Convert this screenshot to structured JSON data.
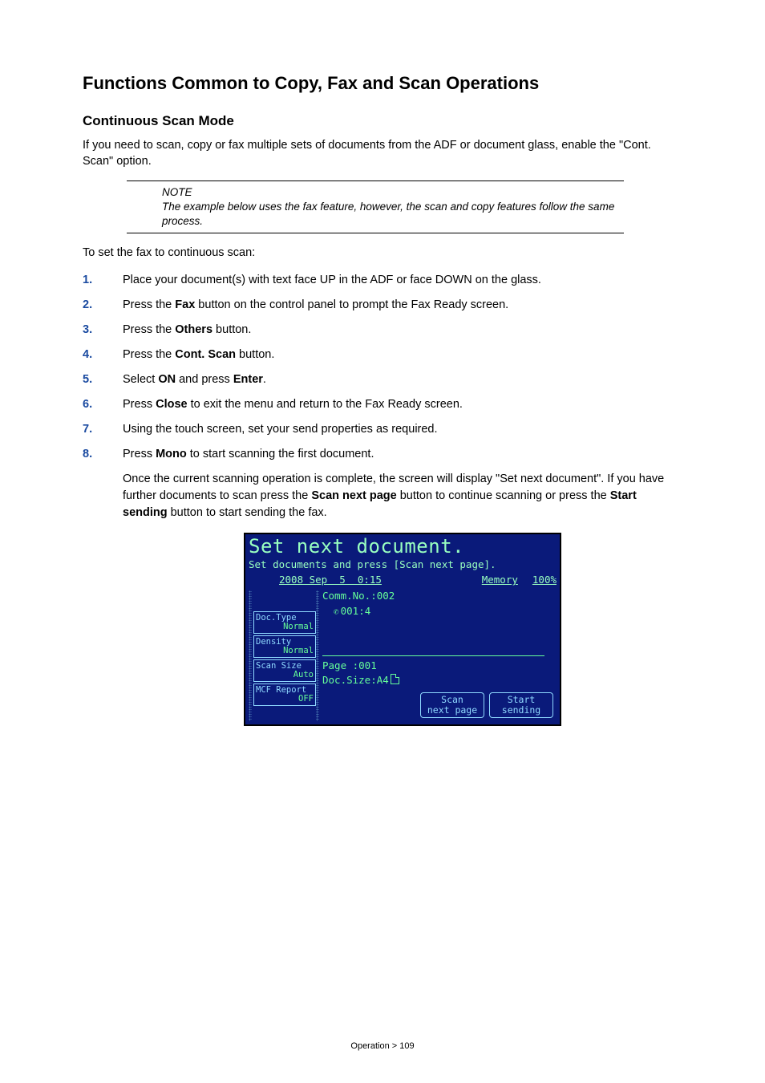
{
  "section": {
    "title": "Functions Common to Copy, Fax and Scan Operations",
    "subtitle": "Continuous Scan Mode",
    "intro": "If you need to scan, copy or fax multiple sets of documents from the ADF or document glass, enable the \"Cont. Scan\" option."
  },
  "note": {
    "label": "NOTE",
    "text": "The example below uses the fax feature, however, the scan and copy features follow the same process."
  },
  "steps_intro": "To set the fax to continuous scan:",
  "steps": [
    {
      "pre": "Place your document(s) with text face UP in the ADF or face DOWN on the glass."
    },
    {
      "pre": "Press the ",
      "bold": "Fax",
      "post": " button on the control panel to prompt the Fax Ready screen."
    },
    {
      "pre": "Press the ",
      "bold": "Others",
      "post": " button."
    },
    {
      "pre": "Press the ",
      "bold": "Cont. Scan",
      "post": " button."
    },
    {
      "pre": "Select ",
      "bold": "ON",
      "post": " and press ",
      "bold2": "Enter",
      "post2": "."
    },
    {
      "pre": "Press ",
      "bold": "Close",
      "post": " to exit the menu and return to the Fax Ready screen."
    },
    {
      "pre": "Using the touch screen, set your send properties as required."
    },
    {
      "pre": "Press ",
      "bold": "Mono",
      "post": " to start scanning the first document."
    }
  ],
  "step8_para": {
    "p1": "Once the current scanning operation is complete, the screen will display \"Set next document\". If you have further documents to scan press the ",
    "b1": "Scan next page",
    "p2": " button to continue scanning or press the ",
    "b2": "Start sending",
    "p3": " button to start sending the fax."
  },
  "screen": {
    "title": "Set next document.",
    "subtitle": "Set documents and press [Scan next page].",
    "datetime": "2008 Sep  5  0:15",
    "memory_label": "Memory",
    "memory_pct": "100%",
    "comm": "Comm.No.:002",
    "dial": "001:4",
    "tabs": [
      {
        "l1": "Doc.Type",
        "l2": "Normal"
      },
      {
        "l1": "Density",
        "l2": "Normal"
      },
      {
        "l1": "Scan Size",
        "l2": "Auto"
      },
      {
        "l1": "MCF Report",
        "l2": "OFF"
      }
    ],
    "page_line": "Page :001",
    "docsize_line": "Doc.Size:A4",
    "btn_scan_l1": "Scan",
    "btn_scan_l2": "next page",
    "btn_start_l1": "Start",
    "btn_start_l2": "sending"
  },
  "footer": "Operation > 109"
}
